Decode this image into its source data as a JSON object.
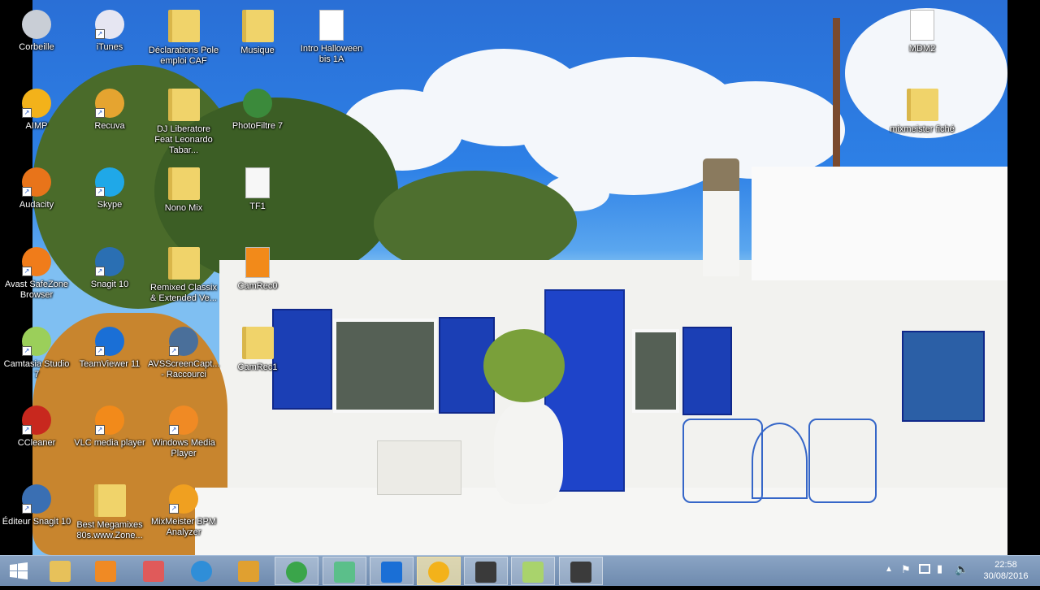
{
  "desktop": {
    "icons": [
      {
        "label": "Corbeille",
        "icon": "recycle-bin-icon",
        "shortcut": false
      },
      {
        "label": "iTunes",
        "icon": "itunes-icon",
        "shortcut": true
      },
      {
        "label": "Déclarations Pole emploi  CAF",
        "icon": "folder-icon",
        "shortcut": false
      },
      {
        "label": "Musique",
        "icon": "music-folder-icon",
        "shortcut": false
      },
      {
        "label": "Intro Halloween bis 1A",
        "icon": "mp3-file-icon",
        "shortcut": false
      },
      {
        "label": "MDM2",
        "icon": "wav-file-icon",
        "shortcut": false
      },
      {
        "label": "AIMP",
        "icon": "aimp-icon",
        "shortcut": true
      },
      {
        "label": "Recuva",
        "icon": "recuva-icon",
        "shortcut": true
      },
      {
        "label": "DJ Liberatore Feat Leonardo Tabar...",
        "icon": "folder-icon",
        "shortcut": false
      },
      {
        "label": "PhotoFiltre 7",
        "icon": "photofiltre-icon",
        "shortcut": false
      },
      {
        "label": "mixmeister fiché",
        "icon": "folder-icon",
        "shortcut": false
      },
      {
        "label": "Audacity",
        "icon": "audacity-icon",
        "shortcut": true
      },
      {
        "label": "Skype",
        "icon": "skype-icon",
        "shortcut": true
      },
      {
        "label": "Nono Mix",
        "icon": "folder-icon",
        "shortcut": false
      },
      {
        "label": "TF1",
        "icon": "document-icon",
        "shortcut": false
      },
      {
        "label": "Avast SafeZone Browser",
        "icon": "avast-icon",
        "shortcut": true
      },
      {
        "label": "Snagit 10",
        "icon": "snagit-icon",
        "shortcut": true
      },
      {
        "label": "Remixed Classix & Extended Ve...",
        "icon": "folder-icon",
        "shortcut": false
      },
      {
        "label": "CamRec0",
        "icon": "vlc-file-icon",
        "shortcut": false
      },
      {
        "label": "Camtasia Studio 7",
        "icon": "camtasia-icon",
        "shortcut": true
      },
      {
        "label": "TeamViewer 11",
        "icon": "teamviewer-icon",
        "shortcut": true
      },
      {
        "label": "AVSScreenCapt... - Raccourci",
        "icon": "screen-capture-icon",
        "shortcut": true
      },
      {
        "label": "CamRec1",
        "icon": "folder-icon",
        "shortcut": false
      },
      {
        "label": "CCleaner",
        "icon": "ccleaner-icon",
        "shortcut": true
      },
      {
        "label": "VLC media player",
        "icon": "vlc-icon",
        "shortcut": true
      },
      {
        "label": "Windows Media Player",
        "icon": "windows-media-player-icon",
        "shortcut": true
      },
      {
        "label": "Éditeur Snagit 10",
        "icon": "snagit-editor-icon",
        "shortcut": true
      },
      {
        "label": "Best Megamixes 80s.www.Zone...",
        "icon": "folder-icon",
        "shortcut": false
      },
      {
        "label": "MixMeister BPM Analyzer",
        "icon": "mixmeister-icon",
        "shortcut": true
      }
    ]
  },
  "taskbar": {
    "buttons": [
      {
        "icon": "file-explorer-icon",
        "color": "#e7c15a"
      },
      {
        "icon": "media-player-icon",
        "color": "#f08a24"
      },
      {
        "icon": "paint-icon",
        "color": "#e05a5a"
      },
      {
        "icon": "internet-explorer-icon",
        "color": "#2f8ed8"
      },
      {
        "icon": "archive-icon",
        "color": "#e0a030"
      },
      {
        "icon": "chrome-icon",
        "color": "#3aa54a"
      },
      {
        "icon": "camtasia-icon",
        "color": "#5bbf8a"
      },
      {
        "icon": "teamviewer-icon",
        "color": "#1a6fd6"
      },
      {
        "icon": "aimp-icon",
        "color": "#f3b21a"
      },
      {
        "icon": "mixmeister-icon",
        "color": "#3a3a3a"
      },
      {
        "icon": "notes-icon",
        "color": "#a9d36c"
      },
      {
        "icon": "camcorder-icon",
        "color": "#3b3b3b"
      }
    ],
    "clock": {
      "time": "22:58",
      "date": "30/08/2016"
    },
    "tray_icons": [
      "chevron-up-icon",
      "flag-icon",
      "network-icon",
      "signal-icon",
      "volume-icon"
    ]
  }
}
